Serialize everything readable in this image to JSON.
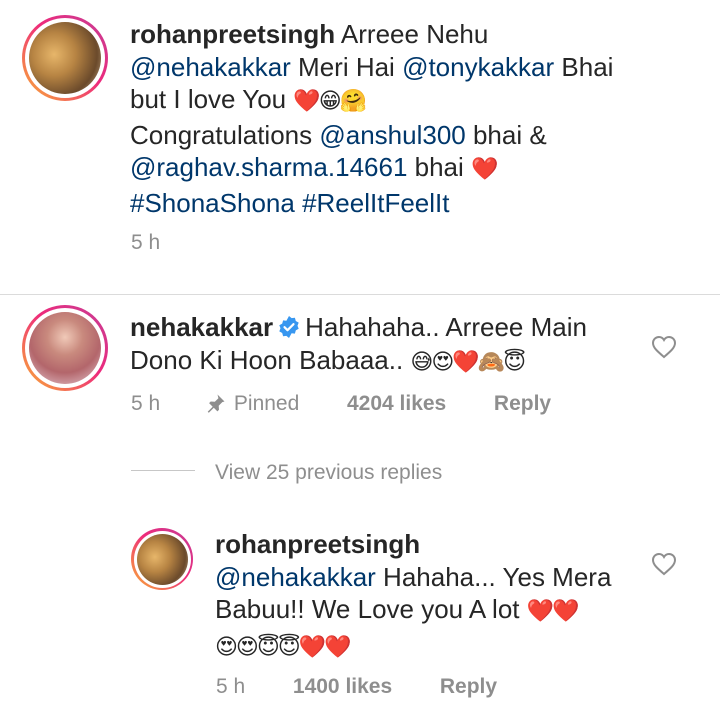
{
  "comment1": {
    "username": "rohanpreetsingh",
    "text_before": " Arreee Nehu ",
    "mention_neha": "@nehakakkar",
    "text_meri_hai": " Meri Hai ",
    "mention_tony": "@tonykakkar",
    "text_bhai": " Bhai but I love You ",
    "emoji1": "❤️😁🤗",
    "text_congrats": "Congratulations ",
    "mention_anshul": "@anshul300",
    "text_bhai_and": " bhai & ",
    "mention_raghav": "@raghav.sharma.14661",
    "text_bhai2": " bhai ",
    "emoji2": "❤️",
    "hashtag1": "#ShonaShona",
    "hashtag2": "#ReelItFeelIt",
    "time": "5 h"
  },
  "comment2": {
    "username": "nehakakkar",
    "text": "Hahahaha.. Arreee Main Dono Ki Hoon Babaaa.. ",
    "emoji": "😅😍❤️🙈😇",
    "time": "5 h",
    "pinned_label": "Pinned",
    "likes": "4204 likes",
    "reply_label": "Reply"
  },
  "view_replies": "View 25 previous replies",
  "reply1": {
    "username": "rohanpreetsingh",
    "mention": "@nehakakkar",
    "text": " Hahaha... Yes Mera Babuu!! We Love you A lot ",
    "emoji1": "❤️❤️",
    "emoji2": "😍😍😇😇❤️❤️",
    "time": "5 h",
    "likes": "1400 likes",
    "reply_label": "Reply"
  }
}
